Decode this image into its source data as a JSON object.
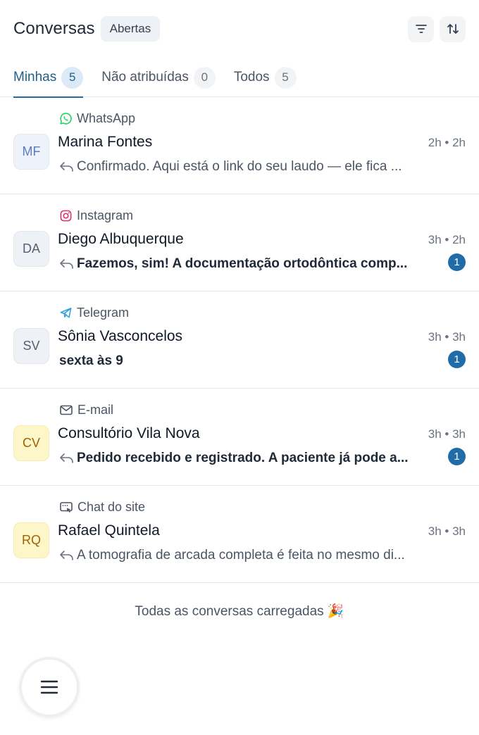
{
  "header": {
    "title": "Conversas",
    "status_filter": "Abertas",
    "filter_icon": "filter-icon",
    "sort_icon": "sort-icon"
  },
  "tabs": [
    {
      "label": "Minhas",
      "count": "5",
      "active": true
    },
    {
      "label": "Não atribuídas",
      "count": "0",
      "active": false
    },
    {
      "label": "Todos",
      "count": "5",
      "active": false
    }
  ],
  "conversations": [
    {
      "channel": "WhatsApp",
      "channel_icon": "whatsapp-icon",
      "initials": "MF",
      "name": "Marina Fontes",
      "time": "2h • 2h",
      "preview": "Confirmado. Aqui está o link do seu laudo — ele fica ...",
      "replied": true,
      "unread": false,
      "unread_count": ""
    },
    {
      "channel": "Instagram",
      "channel_icon": "instagram-icon",
      "initials": "DA",
      "name": "Diego Albuquerque",
      "time": "3h • 2h",
      "preview": "Fazemos, sim! A documentação ortodôntica comp...",
      "replied": true,
      "unread": true,
      "unread_count": "1"
    },
    {
      "channel": "Telegram",
      "channel_icon": "telegram-icon",
      "initials": "SV",
      "name": "Sônia Vasconcelos",
      "time": "3h • 3h",
      "preview": "sexta às 9",
      "replied": false,
      "unread": true,
      "unread_count": "1"
    },
    {
      "channel": "E-mail",
      "channel_icon": "email-icon",
      "initials": "CV",
      "name": "Consultório Vila Nova",
      "time": "3h • 3h",
      "preview": "Pedido recebido e registrado. A paciente já pode a...",
      "replied": true,
      "unread": true,
      "unread_count": "1"
    },
    {
      "channel": "Chat do site",
      "channel_icon": "website-chat-icon",
      "initials": "RQ",
      "name": "Rafael Quintela",
      "time": "3h • 3h",
      "preview": "A tomografia de arcada completa é feita no mesmo di...",
      "replied": true,
      "unread": false,
      "unread_count": ""
    }
  ],
  "footer_note": "Todas as conversas carregadas 🎉",
  "menu_icon": "menu-icon",
  "colors": {
    "accent": "#1f6ca8",
    "avatar_blue_bg": "#eef2fb",
    "avatar_blue_fg": "#5b7bc6",
    "avatar_gray_bg": "#eef1f6",
    "avatar_gray_fg": "#556070",
    "avatar_yellow_bg": "#fdf6c8",
    "avatar_yellow_fg": "#a16207",
    "whatsapp": "#25d366",
    "instagram": "#e1306c",
    "telegram": "#2aa1da"
  }
}
